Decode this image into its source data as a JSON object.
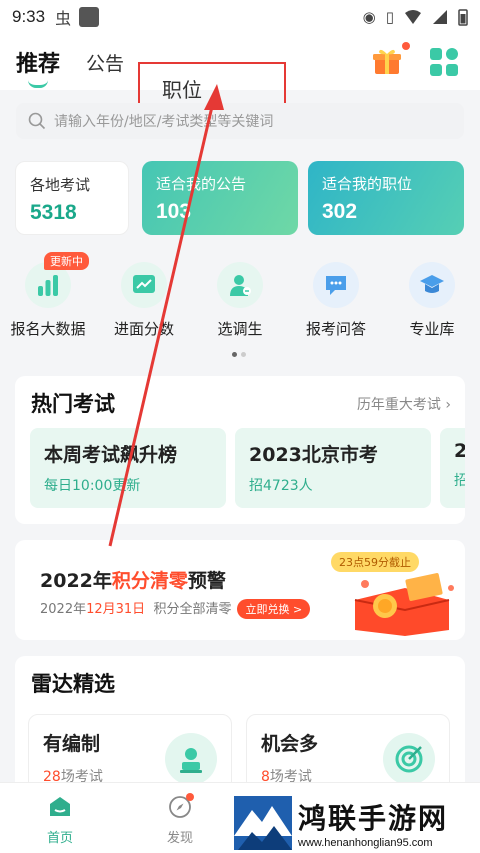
{
  "status_bar": {
    "time": "9:33"
  },
  "nav": {
    "tabs": [
      {
        "label": "推荐"
      },
      {
        "label": "公告"
      },
      {
        "label": "职位"
      }
    ]
  },
  "search": {
    "placeholder": "请输入年份/地区/考试类型等关键词"
  },
  "stats": [
    {
      "label": "各地考试",
      "value": "5318"
    },
    {
      "label": "适合我的公告",
      "value": "103"
    },
    {
      "label": "适合我的职位",
      "value": "302"
    }
  ],
  "quick_links": [
    {
      "label": "报名大数据",
      "badge": "更新中",
      "icon": "bar-chart-icon"
    },
    {
      "label": "进面分数",
      "icon": "line-chart-icon"
    },
    {
      "label": "选调生",
      "icon": "person-swap-icon"
    },
    {
      "label": "报考问答",
      "icon": "chat-bubble-icon"
    },
    {
      "label": "专业库",
      "icon": "graduation-cap-icon"
    }
  ],
  "hot_exams": {
    "title": "热门考试",
    "more": "历年重大考试",
    "items": [
      {
        "title": "本周考试飙升榜",
        "sub": "每日10:00更新"
      },
      {
        "title": "2023北京市考",
        "sub": "招4723人"
      },
      {
        "title": "2",
        "sub": "招"
      }
    ]
  },
  "banner": {
    "title_pre": "2022年",
    "title_hl": "积分清零",
    "title_post": "预警",
    "sub_pre": "2022年",
    "sub_date": "12月31日",
    "sub_post": "积分全部清零",
    "button": "立即兑换 >",
    "deadline": "23点59分截止"
  },
  "radar": {
    "title": "雷达精选",
    "items": [
      {
        "title": "有编制",
        "num": "28",
        "unit": "场考试"
      },
      {
        "title": "机会多",
        "num": "8",
        "unit": "场考试"
      }
    ]
  },
  "tabbar": [
    {
      "label": "首页"
    },
    {
      "label": "发现"
    }
  ],
  "watermark": {
    "name": "鸿联手游网",
    "url": "www.henanhonglian95.com"
  },
  "colors": {
    "accent": "#2fae8d",
    "highlight": "#ff4d2d",
    "annotation": "#e53935"
  }
}
